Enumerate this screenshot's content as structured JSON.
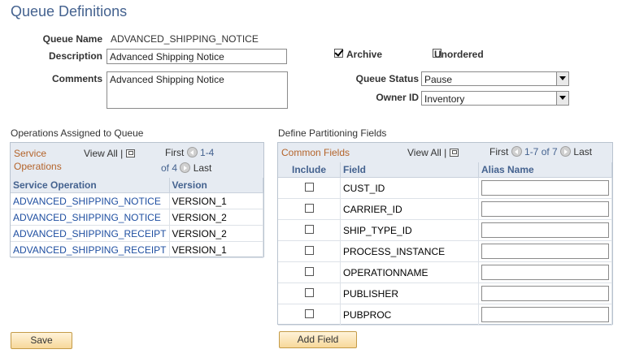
{
  "page_title": "Queue Definitions",
  "queue_name": {
    "label": "Queue Name",
    "value": "ADVANCED_SHIPPING_NOTICE"
  },
  "description": {
    "label": "Description",
    "value": "Advanced Shipping Notice"
  },
  "comments": {
    "label": "Comments",
    "value": "Advanced Shipping Notice"
  },
  "archive": {
    "label": "Archive",
    "checked": true
  },
  "unordered": {
    "label": "Unordered",
    "checked": false
  },
  "queue_status": {
    "label": "Queue Status",
    "value": "Pause"
  },
  "owner_id": {
    "label": "Owner ID",
    "value": "Inventory"
  },
  "operations": {
    "section_title": "Operations Assigned to Queue",
    "caption_line1": "Service",
    "caption_line2": "Operations",
    "view_all": "View All",
    "first": "First",
    "range": "1-4",
    "of": "of 4",
    "last": "Last",
    "columns": [
      "Service Operation",
      "Version"
    ],
    "rows": [
      [
        "ADVANCED_SHIPPING_NOTICE",
        "VERSION_1"
      ],
      [
        "ADVANCED_SHIPPING_NOTICE",
        "VERSION_2"
      ],
      [
        "ADVANCED_SHIPPING_RECEIPT",
        "VERSION_2"
      ],
      [
        "ADVANCED_SHIPPING_RECEIPT",
        "VERSION_1"
      ]
    ]
  },
  "partitioning": {
    "section_title": "Define Partitioning Fields",
    "caption": "Common Fields",
    "view_all": "View All",
    "first": "First",
    "range": "1-7 of 7",
    "last": "Last",
    "columns": [
      "Include",
      "Field",
      "Alias Name"
    ],
    "rows": [
      {
        "field": "CUST_ID",
        "include": false,
        "alias": ""
      },
      {
        "field": "CARRIER_ID",
        "include": false,
        "alias": ""
      },
      {
        "field": "SHIP_TYPE_ID",
        "include": false,
        "alias": ""
      },
      {
        "field": "PROCESS_INSTANCE",
        "include": false,
        "alias": ""
      },
      {
        "field": "OPERATIONNAME",
        "include": false,
        "alias": ""
      },
      {
        "field": "PUBLISHER",
        "include": false,
        "alias": ""
      },
      {
        "field": "PUBPROC",
        "include": false,
        "alias": ""
      }
    ]
  },
  "buttons": {
    "save": "Save",
    "add_field": "Add Field"
  },
  "colors": {
    "title": "#44628f",
    "caption": "#b4642b",
    "link": "#1f4fa1",
    "header_bg": "#e6ebf2"
  }
}
